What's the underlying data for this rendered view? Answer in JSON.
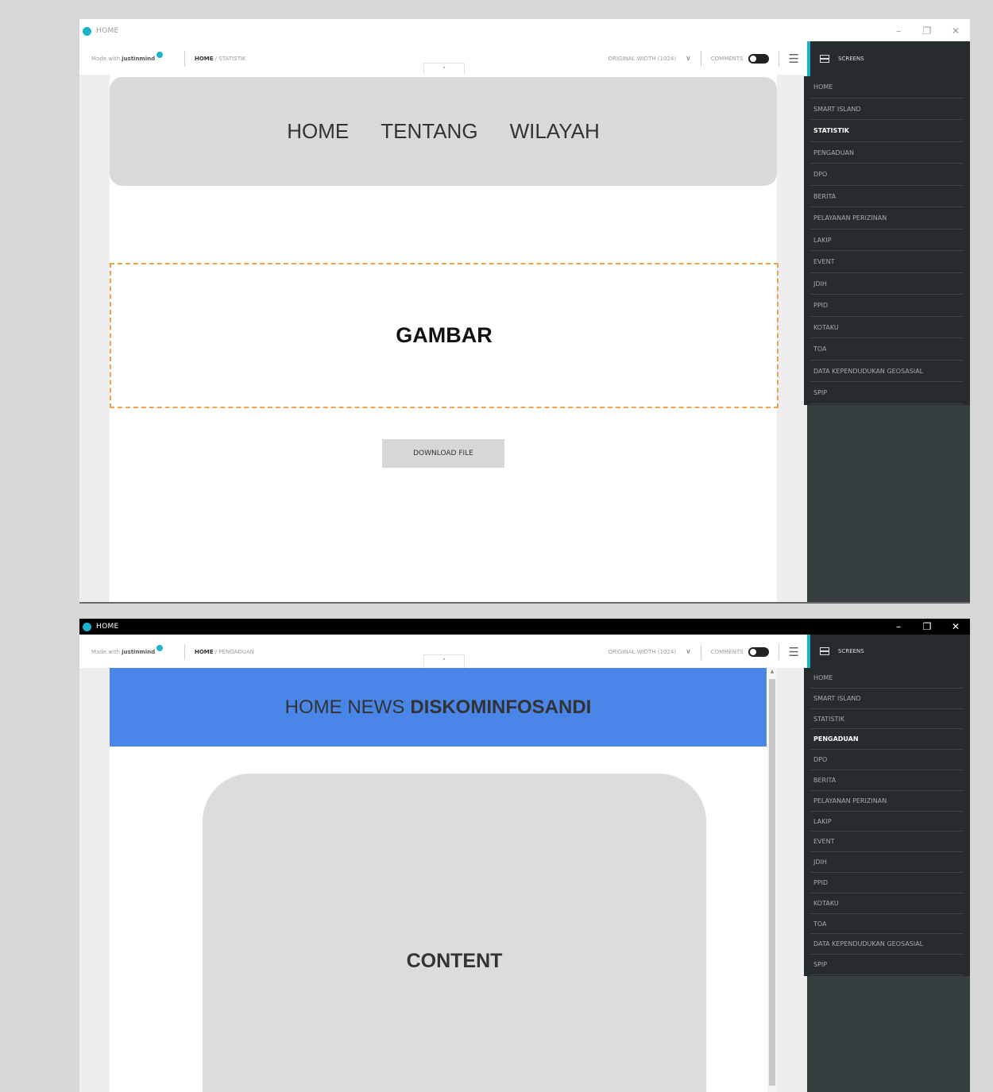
{
  "window1": {
    "title": "HOME",
    "brand": {
      "prefix": "Made with",
      "name": "justinmind"
    },
    "breadcrumb": {
      "home": "HOME",
      "rest": " / STATISTIK"
    },
    "toolbar": {
      "width_label": "ORIGINAL WIDTH (1024)",
      "comments_label": "COMMENTS"
    },
    "nav": [
      "HOME",
      "TENTANG",
      "WILAYAH"
    ],
    "image_placeholder": "GAMBAR",
    "download_button": "DOWNLOAD FILE",
    "sidebar": {
      "title": "SCREENS",
      "items": [
        "HOME",
        "SMART ISLAND",
        "STATISTIK",
        "PENGADUAN",
        "DPO",
        "BERITA",
        "PELAYANAN PERIZINAN",
        "LAKIP",
        "EVENT",
        "JDIH",
        "PPID",
        "KOTAKU",
        "TOA",
        "DATA KEPENDUDUKAN GEOSASIAL",
        "SPIP"
      ],
      "active": "STATISTIK"
    }
  },
  "window2": {
    "title": "HOME",
    "brand": {
      "prefix": "Made with",
      "name": "justinmind"
    },
    "breadcrumb": {
      "home": "HOME",
      "rest": " / PENGADUAN"
    },
    "toolbar": {
      "width_label": "ORIGINAL WIDTH (1024)",
      "comments_label": "COMMENTS"
    },
    "header": {
      "normal": "HOME NEWS",
      "bold": "DISKOMINFOSANDI"
    },
    "content_placeholder": "CONTENT",
    "sidebar": {
      "title": "SCREENS",
      "items": [
        "HOME",
        "SMART ISLAND",
        "STATISTIK",
        "PENGADUAN",
        "DPO",
        "BERITA",
        "PELAYANAN PERIZINAN",
        "LAKIP",
        "EVENT",
        "JDIH",
        "PPID",
        "KOTAKU",
        "TOA",
        "DATA KEPENDUDUKAN GEOSASIAL",
        "SPIP"
      ],
      "active": "PENGADUAN"
    }
  },
  "icons": {
    "minimize": "minimize-icon",
    "maximize": "restore-icon",
    "close": "close-icon",
    "menu": "hamburger-icon",
    "dropdown": "chevron-down-icon",
    "collapse": "chevron-up-icon",
    "screens": "screens-icon"
  },
  "colors": {
    "accent": "#1bb3c9",
    "header_blue": "#4a86e8",
    "dashed_border": "#f0a24d",
    "sidebar_bg": "#262c2e"
  }
}
